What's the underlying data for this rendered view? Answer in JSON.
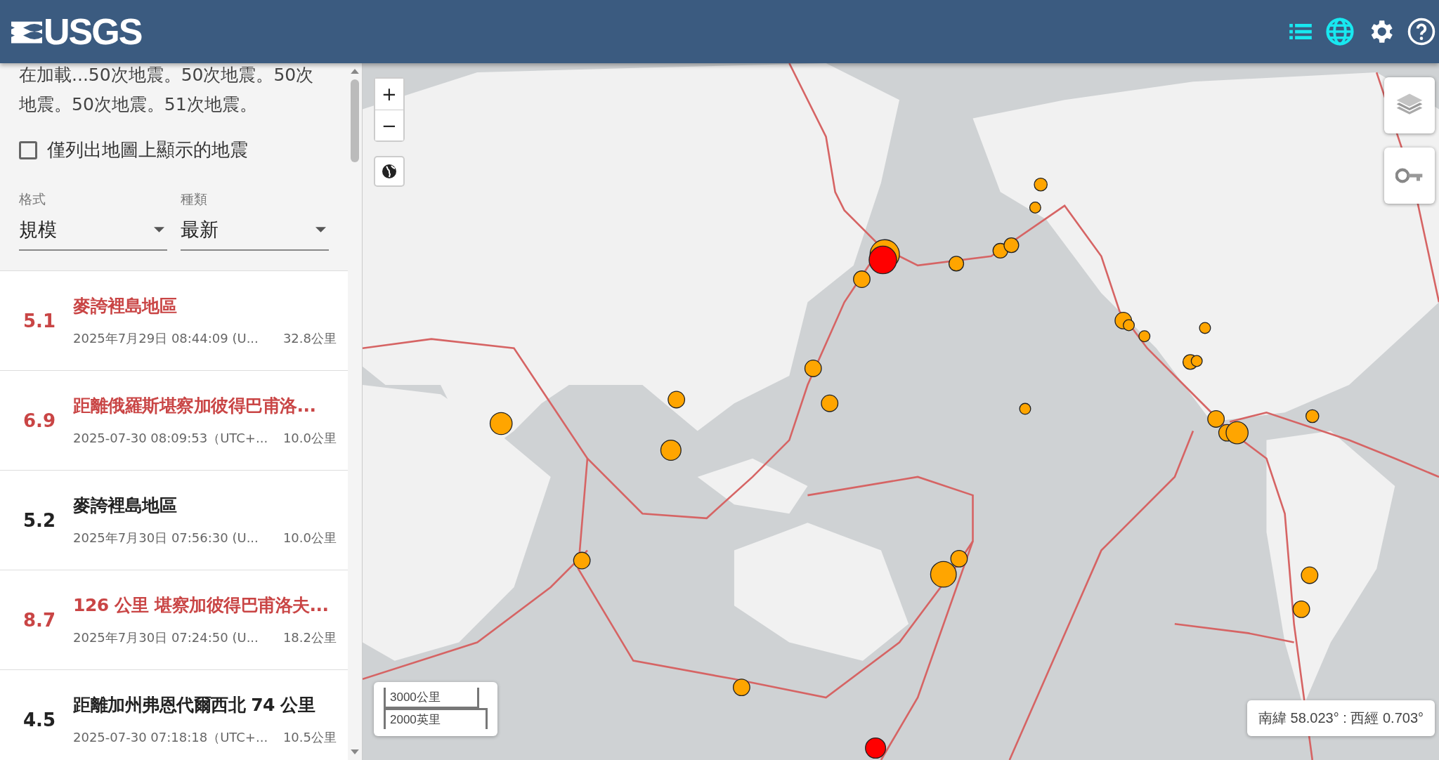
{
  "header": {
    "logo": "USGS"
  },
  "sidebar": {
    "status": "在加載...50次地震。50次地震。50次地震。50次地震。51次地震。",
    "filter_checkbox": {
      "label": "僅列出地圖上顯示的地震",
      "checked": false
    },
    "selects": [
      {
        "label": "格式",
        "value": "規模"
      },
      {
        "label": "種類",
        "value": "最新"
      }
    ],
    "earthquakes": [
      {
        "magnitude": "5.1",
        "title": "麥誇裡島地區",
        "time": "2025年7月29日 08:44:09 (U...",
        "depth": "32.8公里",
        "alert": true
      },
      {
        "magnitude": "6.9",
        "title": "距離俄羅斯堪察加彼得巴甫洛...",
        "time": "2025-07-30 08:09:53（UTC+...",
        "depth": "10.0公里",
        "alert": true
      },
      {
        "magnitude": "5.2",
        "title": "麥誇裡島地區",
        "time": "2025年7月30日 07:56:30 (U...",
        "depth": "10.0公里",
        "alert": false
      },
      {
        "magnitude": "8.7",
        "title": "126 公里 堪察加彼得巴甫洛夫...",
        "time": "2025年7月30日 07:24:50 (U...",
        "depth": "18.2公里",
        "alert": true
      },
      {
        "magnitude": "4.5",
        "title": "距離加州弗恩代爾西北 74 公里",
        "time": "2025-07-30 07:18:18（UTC+...",
        "depth": "10.5公里",
        "alert": false
      }
    ]
  },
  "map": {
    "zoom_in": "+",
    "zoom_out": "−",
    "scale": [
      "3000公里",
      "2000英里"
    ],
    "coordinates": "南緯 58.023° : 西經 0.703°"
  }
}
